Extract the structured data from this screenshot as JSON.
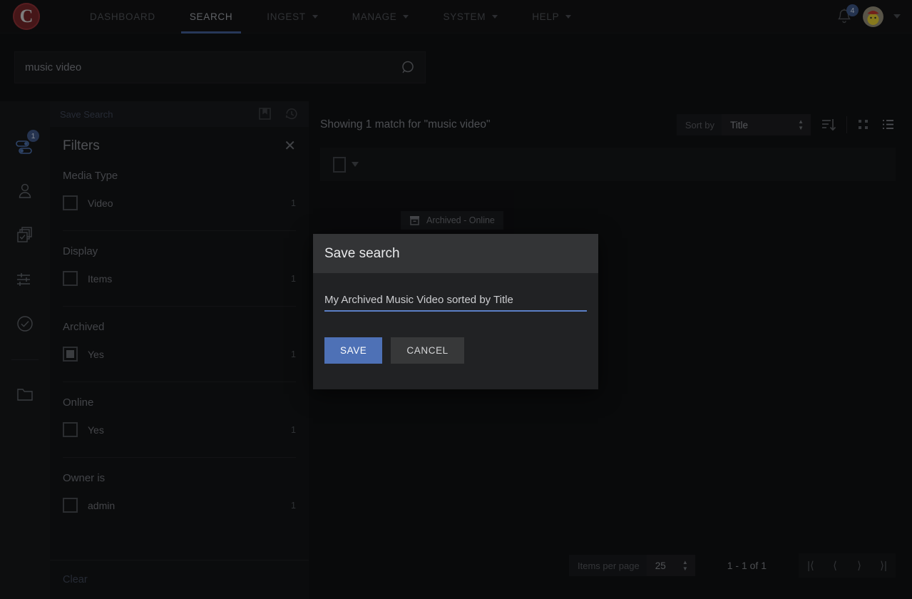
{
  "nav": {
    "logo_text": "C",
    "items": [
      {
        "label": "DASHBOARD",
        "has_caret": false,
        "active": false
      },
      {
        "label": "SEARCH",
        "has_caret": false,
        "active": true
      },
      {
        "label": "INGEST",
        "has_caret": true,
        "active": false
      },
      {
        "label": "MANAGE",
        "has_caret": true,
        "active": false
      },
      {
        "label": "SYSTEM",
        "has_caret": true,
        "active": false
      },
      {
        "label": "HELP",
        "has_caret": true,
        "active": false
      }
    ],
    "notifications_badge": "4",
    "bell_icon": "bell-icon",
    "avatar_icon": "user-avatar",
    "account_caret_icon": "chevron-down-icon"
  },
  "search": {
    "value": "music video",
    "placeholder": "Search",
    "icon": "search-icon"
  },
  "rail": {
    "items": [
      {
        "icon": "filter-toggles-icon",
        "badge": "1",
        "active": true
      },
      {
        "icon": "person-icon",
        "badge": "",
        "active": false
      },
      {
        "icon": "multi-select-icon",
        "badge": "",
        "active": false
      },
      {
        "icon": "adjustments-sliders-icon",
        "badge": "",
        "active": false
      },
      {
        "icon": "check-circle-icon",
        "badge": "",
        "active": false
      },
      {
        "icon": "folder-icon",
        "badge": "",
        "active": false
      }
    ]
  },
  "save_search_bar": {
    "label": "Save Search",
    "bookmark_icon": "bookmark-save-icon",
    "history_icon": "history-clock-icon"
  },
  "filters": {
    "title": "Filters",
    "close_icon": "close-icon",
    "clear_label": "Clear",
    "groups": [
      {
        "title": "Media Type",
        "rows": [
          {
            "label": "Video",
            "count": "1",
            "checked": false
          }
        ]
      },
      {
        "title": "Display",
        "rows": [
          {
            "label": "Items",
            "count": "1",
            "checked": false
          }
        ]
      },
      {
        "title": "Archived",
        "rows": [
          {
            "label": "Yes",
            "count": "1",
            "checked": true
          }
        ]
      },
      {
        "title": "Online",
        "rows": [
          {
            "label": "Yes",
            "count": "1",
            "checked": false
          }
        ]
      },
      {
        "title": "Owner is",
        "rows": [
          {
            "label": "admin",
            "count": "1",
            "checked": false
          }
        ]
      }
    ]
  },
  "results": {
    "summary": "Showing 1 match for  \"music video\"",
    "sort_by_label": "Sort by",
    "sort_by_value": "Title",
    "sort_direction_icon": "sort-descending-icon",
    "grid_view_icon": "grid-view-icon",
    "list_view_icon": "list-view-icon",
    "select_all_checked": false,
    "card": {
      "status_chip": "Archived - Online",
      "status_chip_icon": "archive-box-icon"
    }
  },
  "pagination": {
    "items_per_page_label": "Items per page",
    "items_per_page_value": "25",
    "range_label": "1 - 1 of 1",
    "first_icon": "first-page-icon",
    "prev_icon": "previous-page-icon",
    "next_icon": "next-page-icon",
    "last_icon": "last-page-icon"
  },
  "modal": {
    "title": "Save search",
    "input_value": "My Archived Music Video sorted by Title",
    "input_placeholder": "Name",
    "save_label": "SAVE",
    "cancel_label": "CANCEL"
  },
  "colors": {
    "accent_blue": "#4e71b6",
    "underline_blue": "#5b7fc7",
    "badge_blue": "#3b5280",
    "logo_red": "#6f2327",
    "modal_header": "#333436",
    "modal_body": "#212224"
  }
}
